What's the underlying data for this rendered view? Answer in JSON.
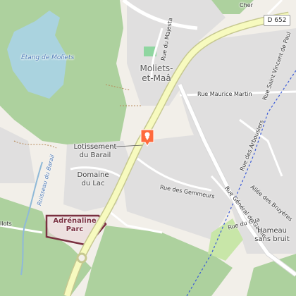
{
  "map": {
    "lake": "Étang de Moliets",
    "stream": "Ruisseau du Barail",
    "town": "Moliets-et-Maâ",
    "road_shield": "D 652",
    "roads": {
      "majesta": "Rue du Majesta",
      "maurice_martin": "Rue Maurice Martin",
      "saint_vincent": "Rue Saint Vincent de Paul",
      "arbousiers": "Rue des Arbousiers",
      "bruyeres": "Allée des Bruyères",
      "general_gaulle": "Rue Général de Gaulle",
      "gemmeurs": "Rue des Gemmeurs",
      "gua": "Rue du Gua",
      "cher": "Cher",
      "llots": "llots"
    },
    "places": {
      "lotissement": "Lotissement du Barail",
      "domaine": "Domaine du Lac",
      "hameau": "Hameau sans bruit"
    },
    "park": "Adrénaline Parc",
    "colors": {
      "forest": "#add19e",
      "residential": "#e0dfdf",
      "road_major": "#f7fabf",
      "road_border": "#c6c890",
      "water": "#aad3df",
      "park_outline": "#7a3040",
      "pin": "#ff6a3d"
    }
  }
}
